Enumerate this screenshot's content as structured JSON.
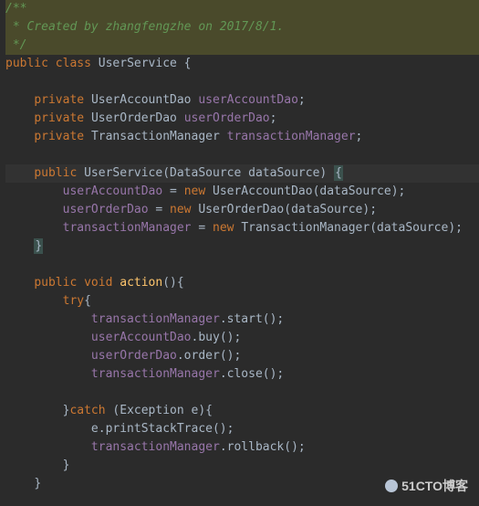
{
  "code": {
    "doc1": "/**",
    "doc2": " * Created by ",
    "doc2_author": "zhangfengzhe",
    "doc2_rest": " on 2017/8/1.",
    "doc3": " */",
    "l1_kw1": "public",
    "l1_kw2": "class",
    "l1_name": "UserService",
    "l1_brace": " {",
    "l2_kw": "private",
    "l2_type": "UserAccountDao",
    "l2_field": "userAccountDao",
    "l3_kw": "private",
    "l3_type": "UserOrderDao",
    "l3_field": "userOrderDao",
    "l4_kw": "private",
    "l4_type": "TransactionManager",
    "l4_field": "transactionManager",
    "l5_kw": "public",
    "l5_name": "UserService",
    "l5_param_type": "DataSource",
    "l5_param_name": "dataSource",
    "l5_brace": "{",
    "l6_f": "userAccountDao",
    "l6_kw": "new",
    "l6_t": "UserAccountDao",
    "l6_arg": "dataSource",
    "l7_f": "userOrderDao",
    "l7_kw": "new",
    "l7_t": "UserOrderDao",
    "l7_arg": "dataSource",
    "l8_f": "transactionManager",
    "l8_kw": "new",
    "l8_t": "TransactionManager",
    "l8_arg": "dataSource",
    "l9_brace": "}",
    "l10_kw1": "public",
    "l10_kw2": "void",
    "l10_name": "action",
    "l10_rest": "(){",
    "l11_kw": "try",
    "l11_brace": "{",
    "l12_f": "transactionManager",
    "l12_m": "start",
    "l13_f": "userAccountDao",
    "l13_m": "buy",
    "l14_f": "userOrderDao",
    "l14_m": "order",
    "l15_f": "transactionManager",
    "l15_m": "close",
    "l16_brace": "}",
    "l16_kw": "catch",
    "l16_rest": " (Exception e){",
    "l17": "e.printStackTrace();",
    "l18_f": "transactionManager",
    "l18_m": "rollback",
    "l19_brace": "}",
    "l20_brace": "}"
  },
  "watermark": "51CTO博客"
}
